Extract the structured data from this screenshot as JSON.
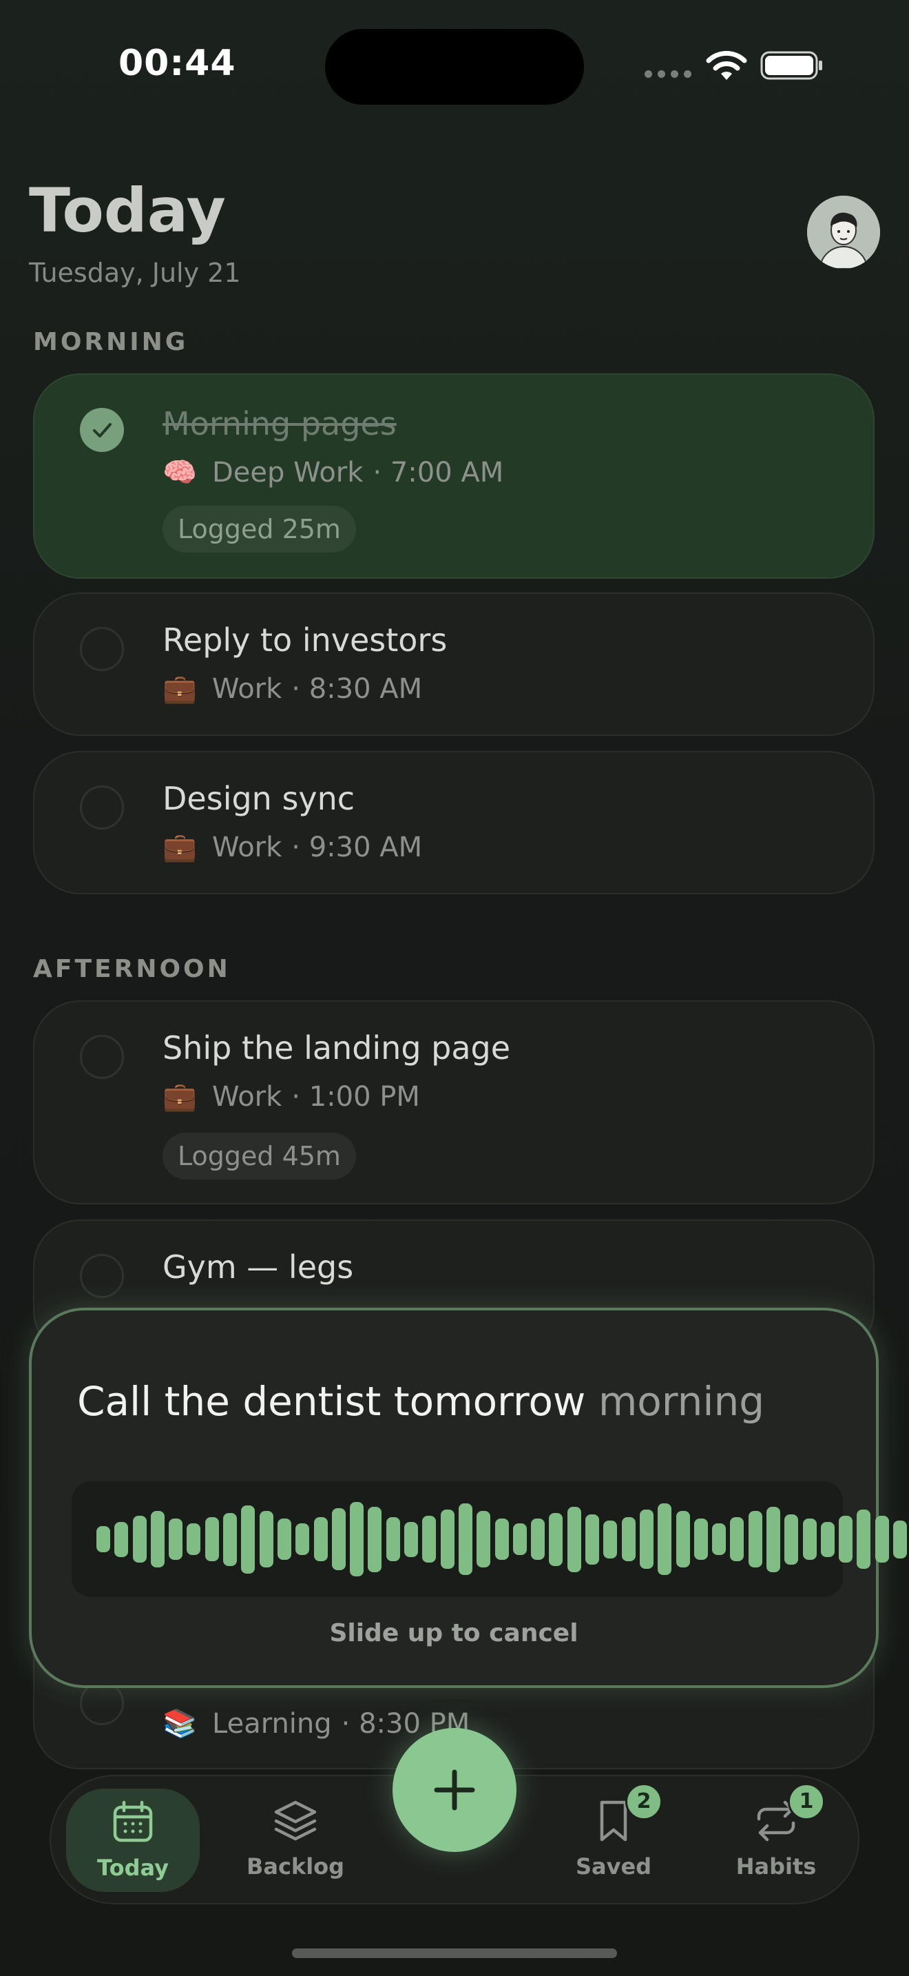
{
  "status_bar": {
    "time": "00:44"
  },
  "header": {
    "title": "Today",
    "date": "Tuesday, July 21"
  },
  "sections": {
    "morning": "MORNING",
    "afternoon": "AFTERNOON"
  },
  "tasks": [
    {
      "title": "Morning pages",
      "emoji": "🧠",
      "category": "Deep Work",
      "time": "· 7:00 AM",
      "logged": "Logged 25m",
      "done": true
    },
    {
      "title": "Reply to investors",
      "emoji": "💼",
      "category": "Work",
      "time": "· 8:30 AM",
      "done": false
    },
    {
      "title": "Design sync",
      "emoji": "💼",
      "category": "Work",
      "time": "· 9:30 AM",
      "done": false
    },
    {
      "title": "Ship the landing page",
      "emoji": "💼",
      "category": "Work",
      "time": "· 1:00 PM",
      "logged": "Logged 45m",
      "done": false
    },
    {
      "title": "Gym — legs",
      "done": false
    },
    {
      "emoji": "📚",
      "category": "Learning",
      "time": "· 8:30 PM",
      "done": false
    }
  ],
  "voice": {
    "transcript": "Call the dentist tomorrow",
    "transcript_pending": "morning",
    "cancel_hint": "Slide up to cancel",
    "levels": [
      0.2,
      0.35,
      0.55,
      0.7,
      0.45,
      0.3,
      0.5,
      0.65,
      0.9,
      0.7,
      0.45,
      0.3,
      0.5,
      0.8,
      1.0,
      0.85,
      0.5,
      0.35,
      0.55,
      0.75,
      0.95,
      0.7,
      0.45,
      0.3,
      0.45,
      0.65,
      0.85,
      0.6,
      0.4,
      0.5,
      0.75,
      0.95,
      0.7,
      0.45,
      0.3,
      0.5,
      0.7,
      0.85,
      0.6,
      0.45,
      0.35,
      0.55,
      0.75,
      0.55,
      0.4,
      0.25
    ],
    "accent": "#7fbd85"
  },
  "tabbar": {
    "today": "Today",
    "backlog": "Backlog",
    "saved": "Saved",
    "saved_badge": "2",
    "habits": "Habits",
    "habits_badge": "1",
    "fab_label": "+"
  }
}
